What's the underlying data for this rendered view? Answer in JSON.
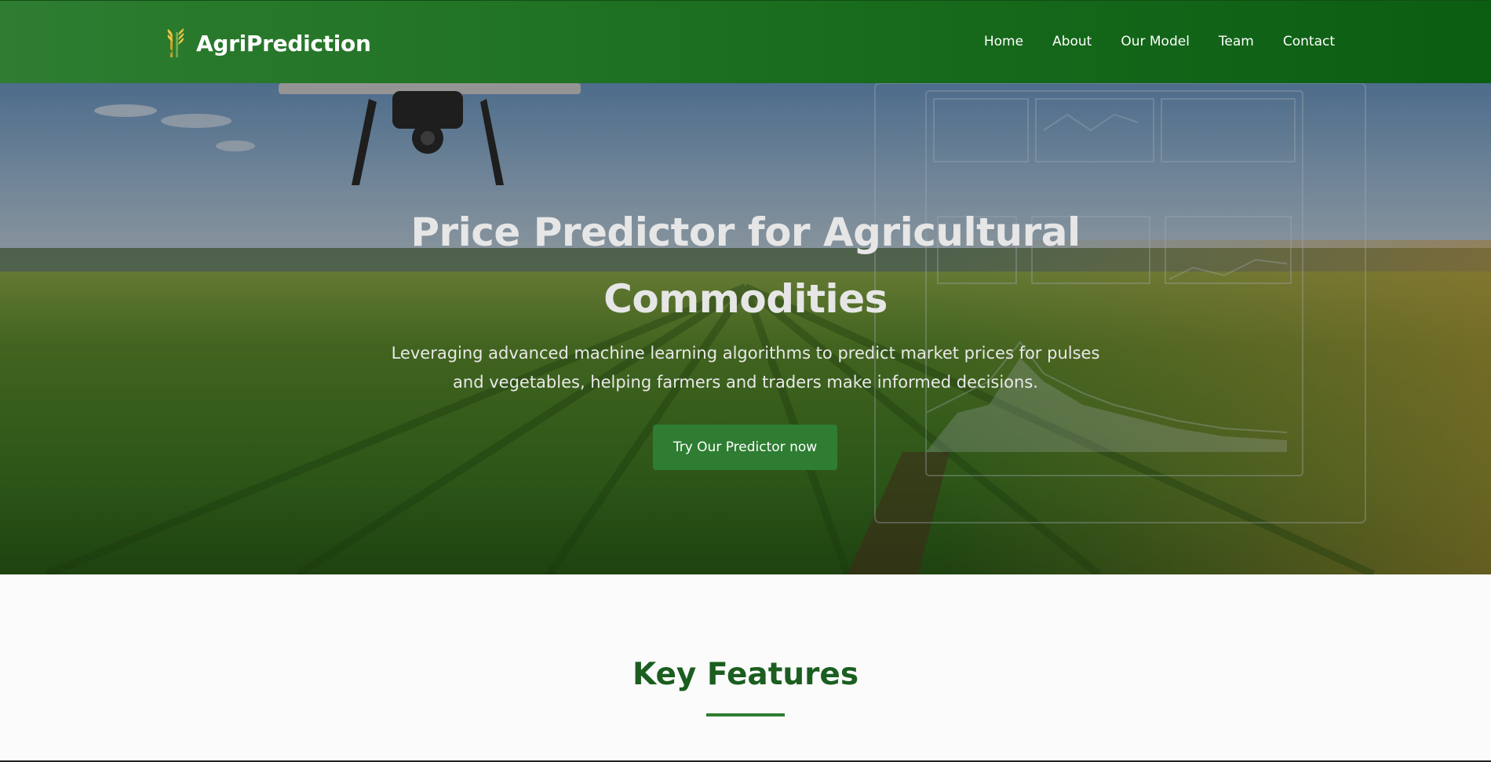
{
  "header": {
    "brand_name": "AgriPrediction",
    "brand_icon": "wheat-icon",
    "nav": [
      {
        "label": "Home"
      },
      {
        "label": "About"
      },
      {
        "label": "Our Model"
      },
      {
        "label": "Team"
      },
      {
        "label": "Contact"
      }
    ]
  },
  "hero": {
    "title": "Price Predictor for Agricultural Commodities",
    "subtitle": "Leveraging advanced machine learning algorithms to predict market prices for pulses and vegetables, helping farmers and traders make informed decisions.",
    "cta_label": "Try Our Predictor now",
    "background_image": "farm-field-drone-dashboard-image"
  },
  "features": {
    "title": "Key Features"
  },
  "colors": {
    "brand_green": "#2e7d32",
    "dark_green": "#1b5e20",
    "nav_gradient_end": "#0b5d12"
  }
}
